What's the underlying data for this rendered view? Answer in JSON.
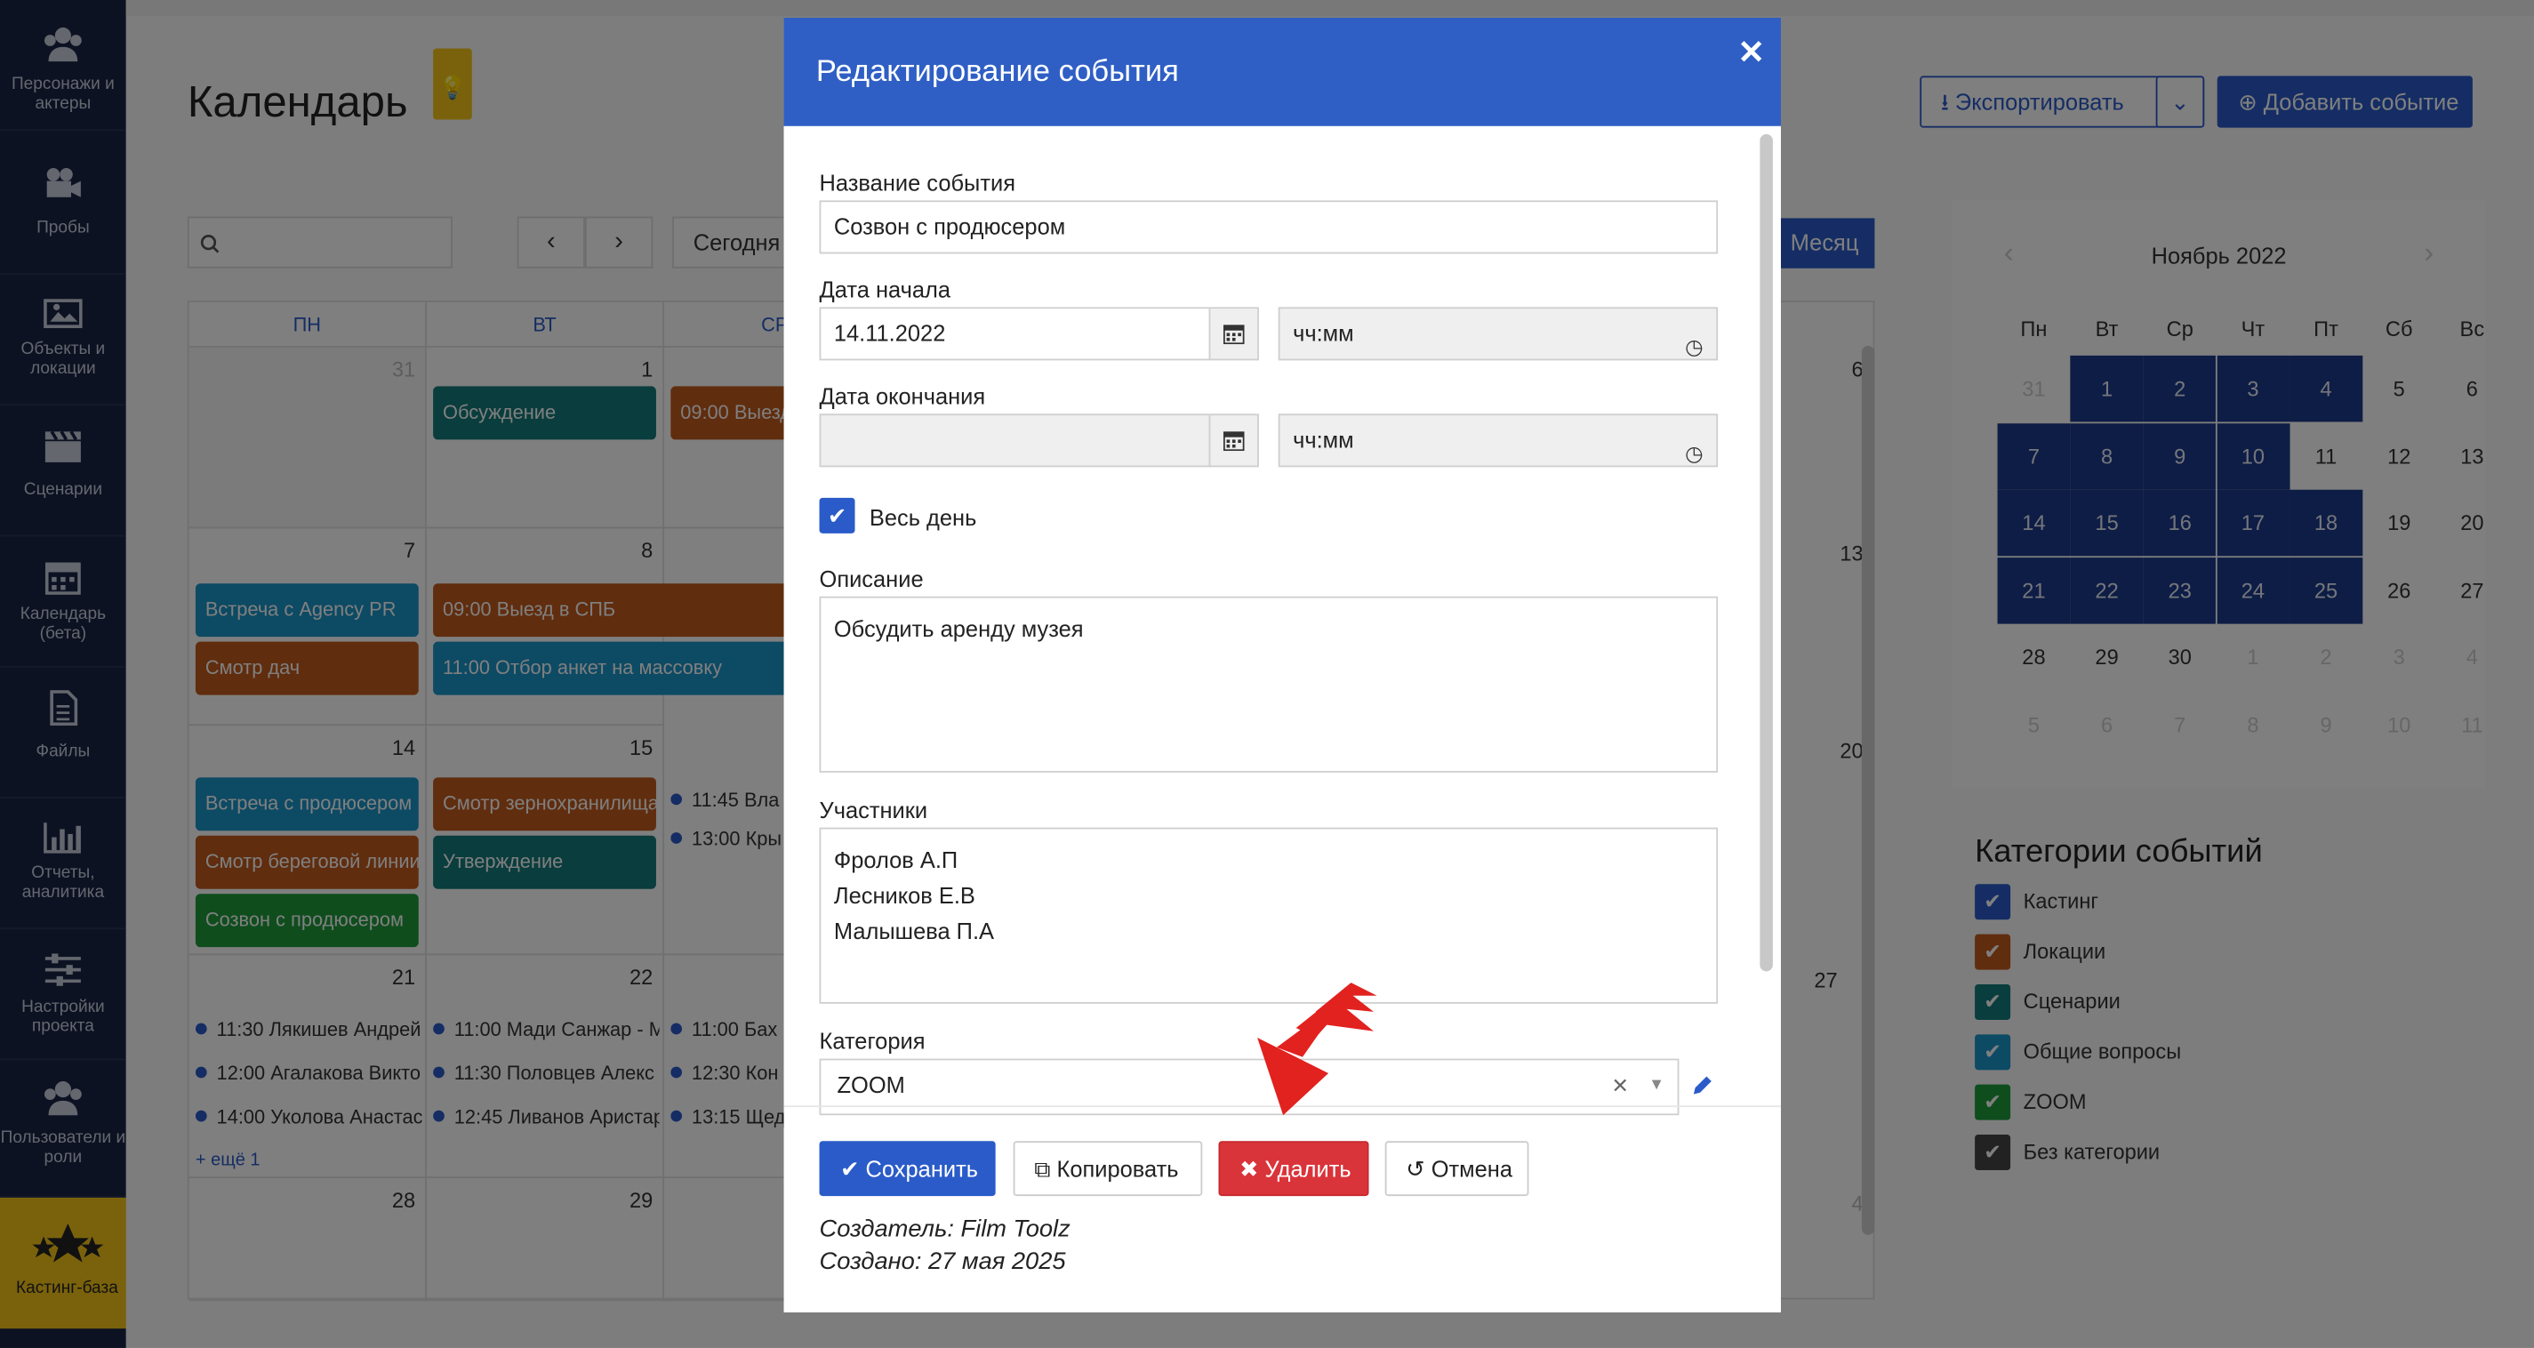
{
  "sidebar": {
    "items": [
      {
        "label": "Персонажи и актеры",
        "icon": "people-icon"
      },
      {
        "label": "Пробы",
        "icon": "video-camera-icon"
      },
      {
        "label": "Объекты и локации",
        "icon": "image-icon"
      },
      {
        "label": "Сценарии",
        "icon": "clapperboard-icon"
      },
      {
        "label": "Календарь (бета)",
        "icon": "calendar-icon"
      },
      {
        "label": "Файлы",
        "icon": "file-icon"
      },
      {
        "label": "Отчеты, аналитика",
        "icon": "bar-chart-icon"
      },
      {
        "label": "Настройки проекта",
        "icon": "sliders-icon"
      },
      {
        "label": "Пользователи и роли",
        "icon": "users-icon"
      },
      {
        "label": "Кастинг-база",
        "icon": "stars-icon"
      }
    ]
  },
  "page": {
    "title": "Календарь",
    "export_label": "Экспортировать",
    "add_event_label": "Добавить событие",
    "today_label": "Сегодня",
    "month_label": "Месяц"
  },
  "calendar": {
    "weekdays": [
      "ПН",
      "ВТ",
      "СР"
    ],
    "weeks": [
      {
        "days": [
          "31",
          "1",
          "",
          "6"
        ],
        "events": [
          [
            "Обсуждение"
          ],
          [
            "09:00 Выезд"
          ]
        ]
      },
      {
        "days": [
          "7",
          "8",
          "13"
        ],
        "events": [
          [
            "Встреча с Agency PR",
            "Смотр дач"
          ],
          [
            "09:00  Выезд в СПБ",
            "11:00  Отбор анкет на массовку"
          ]
        ]
      },
      {
        "days": [
          "14",
          "15",
          "20"
        ],
        "events": [
          [
            "Встреча с продюсером",
            "Смотр береговой линии",
            "Созвон с продюсером"
          ],
          [
            "Смотр зернохранилища",
            "Утверждение"
          ],
          [
            "11:45 Вла",
            "13:00 Кры"
          ]
        ]
      },
      {
        "days": [
          "21",
          "22",
          "27"
        ],
        "events": [
          [
            "11:30 Лякишев Андрей",
            "12:00 Агалакова Викто",
            "14:00 Уколова Анастас"
          ],
          [
            "11:00 Мади Санжар - М",
            "11:30 Половцев Алекс",
            "12:45 Ливанов Аристар"
          ],
          [
            "11:00 Бах",
            "12:30 Кон",
            "13:15 Щед"
          ]
        ],
        "more": "+ ещё 1"
      },
      {
        "days": [
          "28",
          "29",
          "4"
        ]
      }
    ]
  },
  "minical": {
    "title": "Ноябрь 2022",
    "weekdays": [
      "Пн",
      "Вт",
      "Ср",
      "Чт",
      "Пт",
      "Сб",
      "Вс"
    ],
    "days": [
      [
        "31",
        "1",
        "2",
        "3",
        "4",
        "5",
        "6"
      ],
      [
        "7",
        "8",
        "9",
        "10",
        "11",
        "12",
        "13"
      ],
      [
        "14",
        "15",
        "16",
        "17",
        "18",
        "19",
        "20"
      ],
      [
        "21",
        "22",
        "23",
        "24",
        "25",
        "26",
        "27"
      ],
      [
        "28",
        "29",
        "30",
        "1",
        "2",
        "3",
        "4"
      ],
      [
        "5",
        "6",
        "7",
        "8",
        "9",
        "10",
        "11"
      ]
    ]
  },
  "categories": {
    "title": "Категории событий",
    "items": [
      {
        "label": "Кастинг",
        "color": "#2a5bc9"
      },
      {
        "label": "Локации",
        "color": "#c15a1c"
      },
      {
        "label": "Сценарии",
        "color": "#157a7a"
      },
      {
        "label": "Общие вопросы",
        "color": "#1b95c9"
      },
      {
        "label": "ZOOM",
        "color": "#1f9a3a"
      },
      {
        "label": "Без категории",
        "color": "#444444"
      }
    ]
  },
  "modal": {
    "title": "Редактирование события",
    "name_label": "Название события",
    "name_value": "Созвон с продюсером",
    "start_label": "Дата начала",
    "start_date": "14.11.2022",
    "start_time_placeholder": "чч:мм",
    "end_label": "Дата окончания",
    "end_date": "",
    "end_time_placeholder": "чч:мм",
    "allday_label": "Весь день",
    "description_label": "Описание",
    "description_value": "Обсудить аренду музея",
    "participants_label": "Участники",
    "participants": [
      "Фролов А.П",
      "Лесников Е.В",
      "Малышева П.А"
    ],
    "category_label": "Категория",
    "category_value": "ZOOM",
    "save_label": "Сохранить",
    "copy_label": "Копировать",
    "delete_label": "Удалить",
    "cancel_label": "Отмена",
    "creator": "Создатель: Film Toolz",
    "created": "Создано: 27 мая 2025"
  },
  "colors": {
    "primary": "#2a5bc9",
    "teal": "#157a7a",
    "brown": "#c15a1c",
    "sky": "#1b95c9",
    "green": "#1f9a3a",
    "danger": "#d9343a"
  }
}
